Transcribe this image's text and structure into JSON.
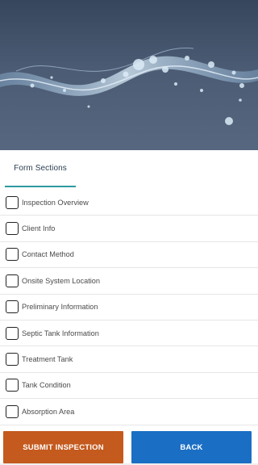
{
  "tabs": {
    "form_sections_label": "Form Sections"
  },
  "sections": [
    {
      "label": "Inspection Overview",
      "checked": false
    },
    {
      "label": "Client Info",
      "checked": false
    },
    {
      "label": "Contact Method",
      "checked": false
    },
    {
      "label": "Onsite System Location",
      "checked": false
    },
    {
      "label": "Preliminary Information",
      "checked": false
    },
    {
      "label": "Septic Tank Information",
      "checked": false
    },
    {
      "label": "Treatment Tank",
      "checked": false
    },
    {
      "label": "Tank Condition",
      "checked": false
    },
    {
      "label": "Absorption Area",
      "checked": false
    }
  ],
  "actions": {
    "submit_label": "SUBMIT INSPECTION",
    "back_label": "BACK"
  },
  "colors": {
    "submit": "#c45a1e",
    "back": "#1a6fc4",
    "tab_underline": "#2e9aa0"
  }
}
